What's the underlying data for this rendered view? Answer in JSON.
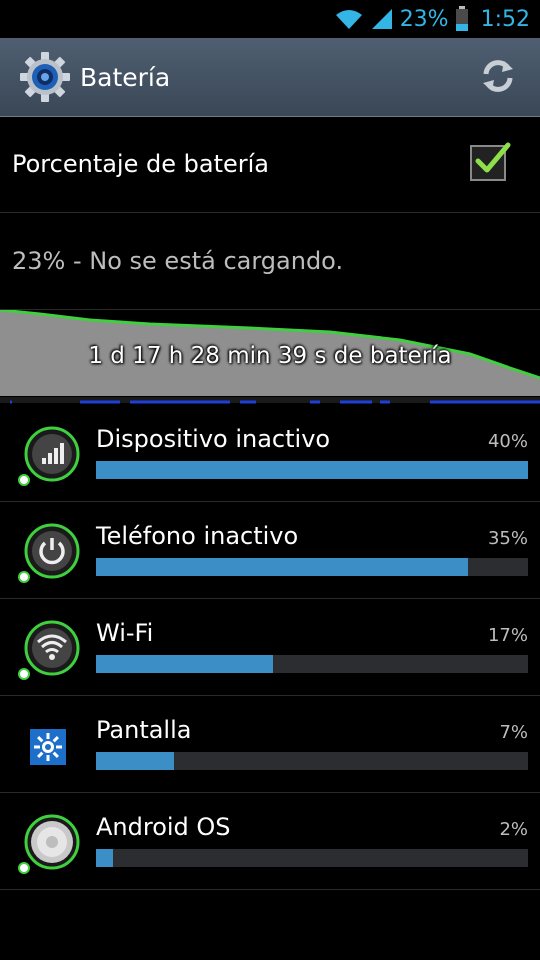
{
  "status_bar": {
    "battery_percent": "23%",
    "time": "1:52",
    "icons": [
      "wifi-icon",
      "signal-icon",
      "battery-icon"
    ],
    "accent": "#33b5e5"
  },
  "action_bar": {
    "title": "Batería",
    "app_icon": "settings-gear-icon",
    "refresh_icon": "refresh-icon"
  },
  "settings": {
    "battery_percentage_label": "Porcentaje de batería",
    "battery_percentage_checked": true,
    "status_text": "23% - No se está cargando."
  },
  "graph": {
    "caption": "1 d 17 h 28 min 39 s de batería",
    "line_color": "#3fcf3f"
  },
  "usage": [
    {
      "name": "Dispositivo inactivo",
      "percent_label": "40%",
      "fraction": 1.0,
      "icon": "cell-standby-icon"
    },
    {
      "name": "Teléfono inactivo",
      "percent_label": "35%",
      "fraction": 0.86,
      "icon": "phone-idle-power-icon"
    },
    {
      "name": "Wi-Fi",
      "percent_label": "17%",
      "fraction": 0.41,
      "icon": "wifi-usage-icon"
    },
    {
      "name": "Pantalla",
      "percent_label": "7%",
      "fraction": 0.18,
      "icon": "screen-brightness-icon"
    },
    {
      "name": "Android OS",
      "percent_label": "2%",
      "fraction": 0.04,
      "icon": "android-os-icon"
    }
  ]
}
